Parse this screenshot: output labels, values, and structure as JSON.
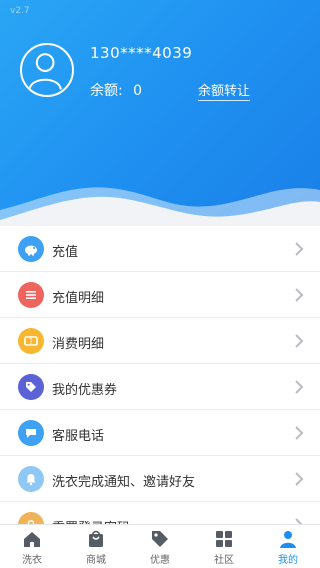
{
  "app": {
    "version": "v2.7"
  },
  "profile": {
    "phone": "130****4039",
    "balance_label": "余额:",
    "balance_value": "0",
    "transfer_link": "余额转让"
  },
  "menu": {
    "items": [
      {
        "label": "充值",
        "icon": "piggy-bank-icon",
        "color": "#3fa1f3"
      },
      {
        "label": "充值明细",
        "icon": "list-icon",
        "color": "#f0645e"
      },
      {
        "label": "消费明细",
        "icon": "ticket-icon",
        "color": "#f7b733"
      },
      {
        "label": "我的优惠券",
        "icon": "tag-icon",
        "color": "#5a62d6"
      },
      {
        "label": "客服电话",
        "icon": "chat-icon",
        "color": "#3fa1f3"
      },
      {
        "label": "洗衣完成通知、邀请好友",
        "icon": "bell-icon",
        "color": "#8fc8f4"
      },
      {
        "label": "重置登录密码",
        "icon": "lock-icon",
        "color": "#f0b35a"
      }
    ]
  },
  "tabbar": {
    "tabs": [
      {
        "label": "洗衣",
        "icon": "home-icon"
      },
      {
        "label": "商城",
        "icon": "shopping-bag-icon"
      },
      {
        "label": "优惠",
        "icon": "tag-icon"
      },
      {
        "label": "社区",
        "icon": "grid-icon"
      },
      {
        "label": "我的",
        "icon": "person-icon",
        "active": true
      }
    ]
  },
  "colors": {
    "primary": "#1e8ff0",
    "inactive": "#555c66"
  }
}
